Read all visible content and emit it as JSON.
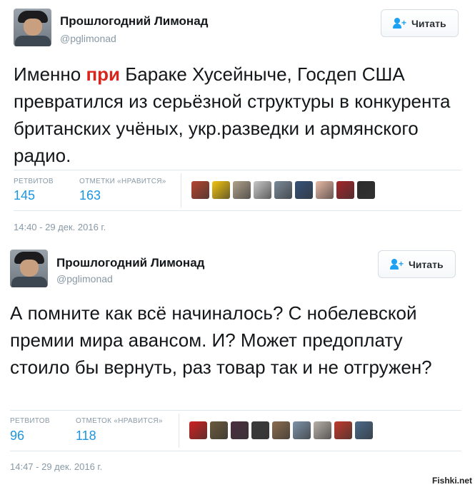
{
  "tweets": [
    {
      "author": {
        "name": "Прошлогодний Лимонад",
        "handle": "@pglimonad"
      },
      "follow_label": "Читать",
      "text_before": "Именно ",
      "text_highlight": "при",
      "text_after": " Бараке Хусейныче, Госдеп США превратился из серьёзной структуры в конкурента британских учёных, укр.разведки и армянского радио.",
      "retweets_label": "РЕТВИТОВ",
      "retweets_count": "145",
      "likes_label": "ОТМЕТКИ «НРАВИТСЯ»",
      "likes_count": "163",
      "liker_avatar_colors": [
        "#b5452f",
        "#f2c40f",
        "#b0a18c",
        "#c8c8c8",
        "#7a8a99",
        "#35527a",
        "#e9b9a6",
        "#a3252a",
        "#2c2c2c"
      ],
      "timestamp": "14:40 - 29 дек. 2016 г."
    },
    {
      "author": {
        "name": "Прошлогодний Лимонад",
        "handle": "@pglimonad"
      },
      "follow_label": "Читать",
      "text": "А помните как всё начиналось? С нобелевской премии мира авансом. И? Может предоплату стоило бы вернуть, раз товар так и не отгружен?",
      "retweets_label": "РЕТВИТОВ",
      "retweets_count": "96",
      "likes_label": "ОТМЕТОК «НРАВИТСЯ»",
      "likes_count": "118",
      "liker_avatar_colors": [
        "#d21f1f",
        "#6b5a3c",
        "#4a2f3f",
        "#3b3b3b",
        "#8c6d4f",
        "#7e93a8",
        "#b7b0a8",
        "#c03a2b",
        "#4a6a8a"
      ],
      "timestamp": "14:47 - 29 дек. 2016 г."
    }
  ],
  "watermark": "Fishki.net",
  "colors": {
    "accent": "#1da1f2",
    "link": "#1b95e0",
    "highlight": "#d9261c",
    "muted": "#8899a6"
  }
}
